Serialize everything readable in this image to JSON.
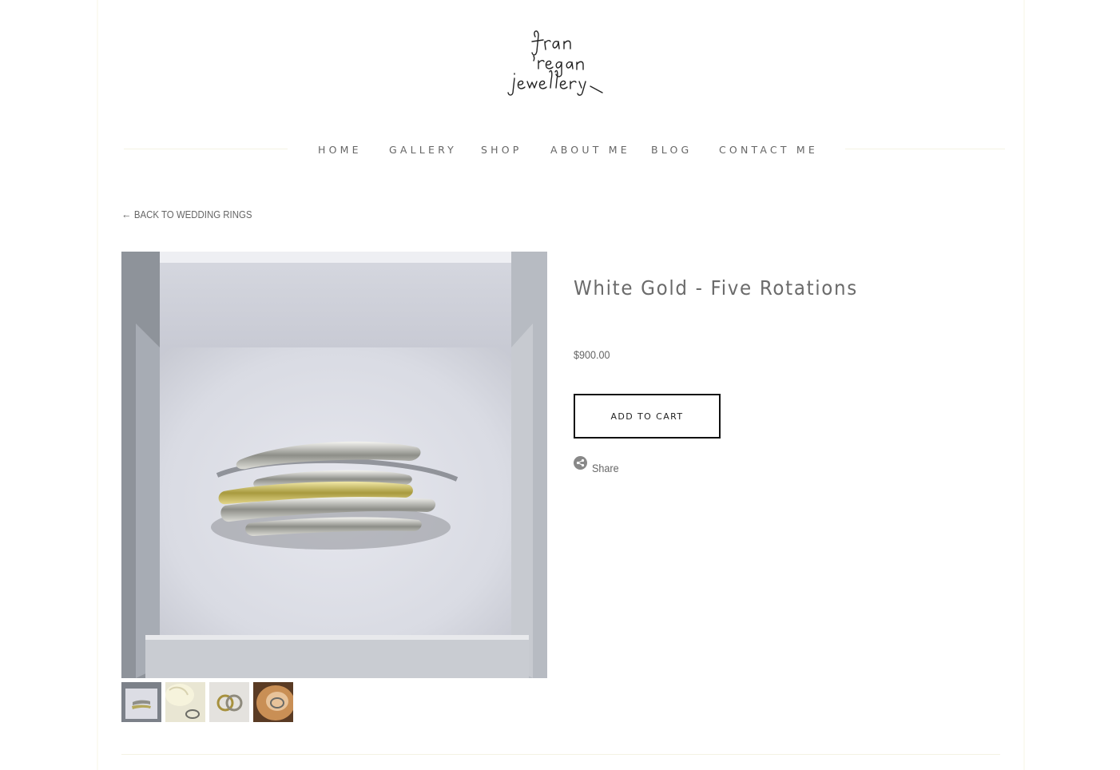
{
  "brand": {
    "logo_text": "fran regan jewellery"
  },
  "nav": {
    "items": [
      {
        "label": "HOME"
      },
      {
        "label": "GALLERY"
      },
      {
        "label": "SHOP"
      },
      {
        "label": "ABOUT ME"
      },
      {
        "label": "BLOG"
      },
      {
        "label": "CONTACT ME"
      }
    ]
  },
  "back_link": {
    "arrow": "←",
    "label": "BACK TO WEDDING RINGS"
  },
  "product": {
    "title": "White Gold - Five Rotations",
    "price": "$900.00",
    "add_to_cart_label": "ADD TO CART",
    "share_label": "Share",
    "thumbnails": [
      {
        "icon": "ring-in-box-thumb"
      },
      {
        "icon": "ring-with-rose-thumb"
      },
      {
        "icon": "two-rings-thumb"
      },
      {
        "icon": "ring-on-shell-thumb"
      }
    ]
  }
}
